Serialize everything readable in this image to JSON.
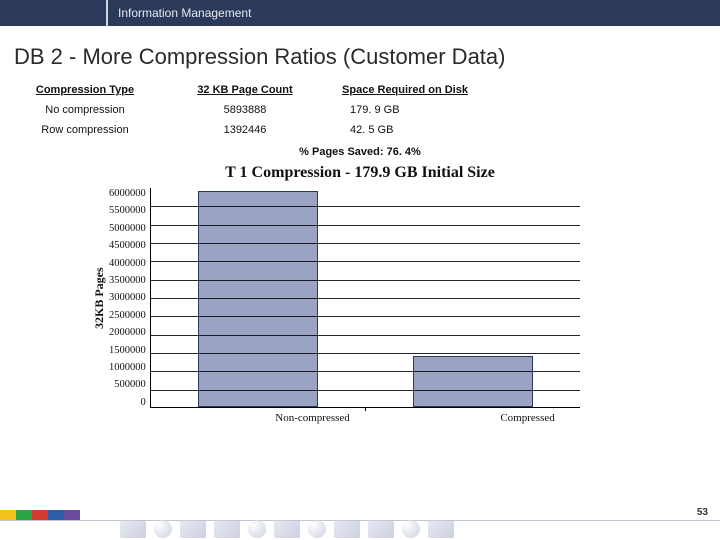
{
  "header": {
    "section": "Information Management",
    "logo_name": "ibm-logo"
  },
  "title": "DB 2 - More Compression Ratios (Customer Data)",
  "table": {
    "headers": [
      "Compression Type",
      "32 KB Page Count",
      "Space Required on Disk"
    ],
    "rows": [
      {
        "type": "No compression",
        "pages": "5893888",
        "space": "179. 9 GB"
      },
      {
        "type": "Row compression",
        "pages": "1392446",
        "space": "42. 5 GB"
      }
    ]
  },
  "pages_saved": "% Pages Saved: 76. 4%",
  "chart_data": {
    "type": "bar",
    "title": "T 1 Compression - 179.9 GB Initial Size",
    "ylabel": "32KB Pages",
    "xlabel": "",
    "ylim": [
      0,
      6000000
    ],
    "yticks": [
      "6000000",
      "5500000",
      "5000000",
      "4500000",
      "4000000",
      "3500000",
      "3000000",
      "2500000",
      "2000000",
      "1500000",
      "1000000",
      "500000",
      "0"
    ],
    "categories": [
      "Non-compressed",
      "Compressed"
    ],
    "values": [
      5893888,
      1392446
    ]
  },
  "footer": {
    "page": "53",
    "stripe_colors": [
      "#f3c21a",
      "#2aa745",
      "#d23b2f",
      "#2d5fa8",
      "#6b4a9e"
    ]
  }
}
